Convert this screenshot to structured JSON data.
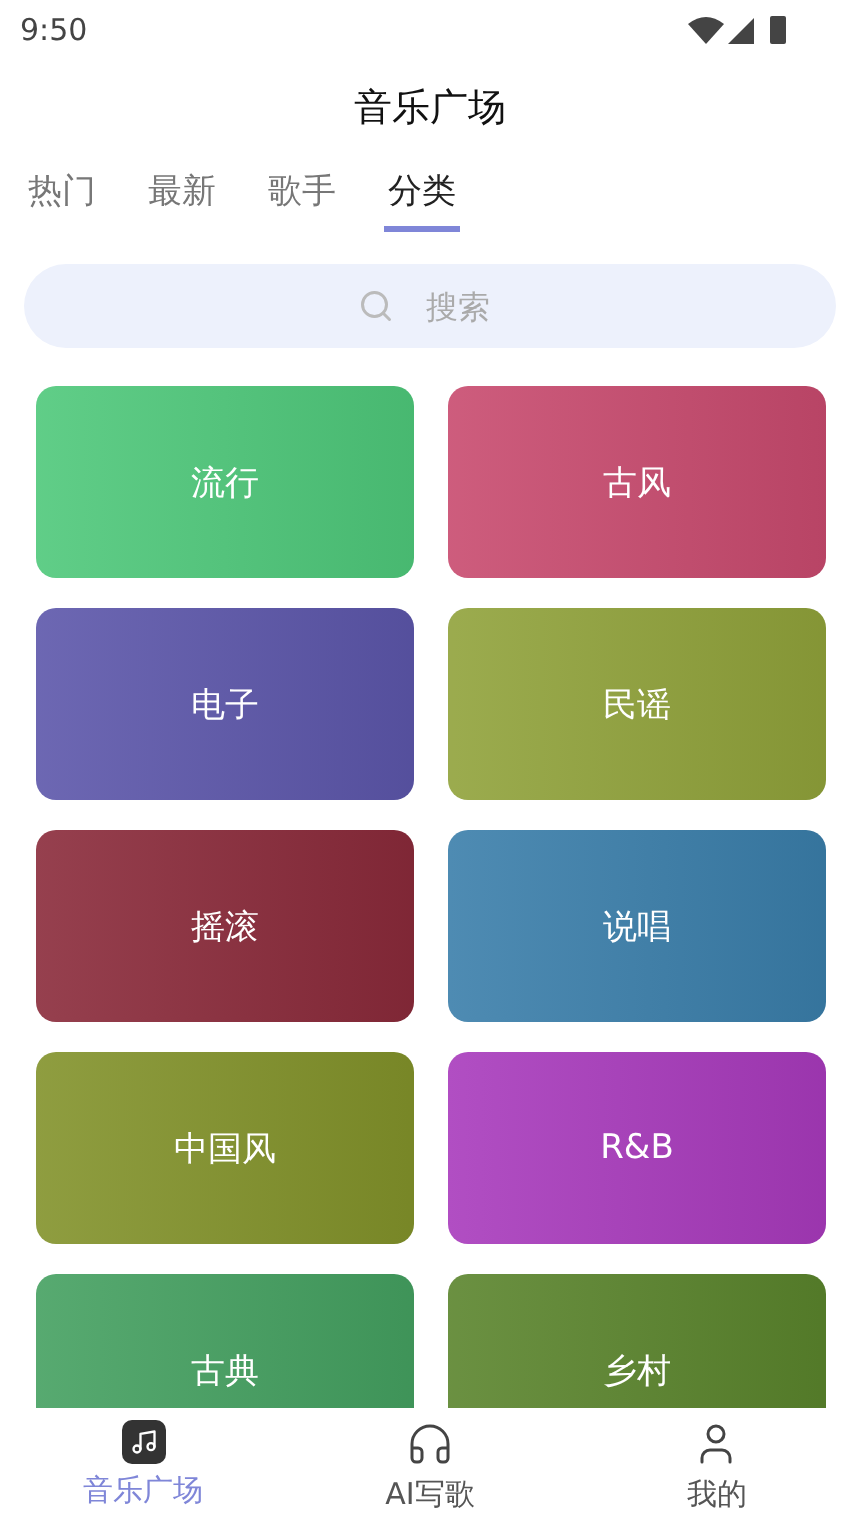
{
  "status_bar": {
    "time": "9:50"
  },
  "title": "音乐广场",
  "tabs": [
    {
      "label": "热门",
      "selected": false
    },
    {
      "label": "最新",
      "selected": false
    },
    {
      "label": "歌手",
      "selected": false
    },
    {
      "label": "分类",
      "selected": true
    }
  ],
  "search": {
    "placeholder": "搜索"
  },
  "categories": [
    {
      "label": "流行",
      "color": "#4ec87a"
    },
    {
      "label": "古风",
      "color": "#c84a6e"
    },
    {
      "label": "电子",
      "color": "#5c56aa"
    },
    {
      "label": "民谣",
      "color": "#90a23a"
    },
    {
      "label": "摇滚",
      "color": "#8a2a3a"
    },
    {
      "label": "说唱",
      "color": "#3a7eaa"
    },
    {
      "label": "中国风",
      "color": "#82922a"
    },
    {
      "label": "R&B",
      "color": "#a83abc"
    },
    {
      "label": "古典",
      "color": "#44a060"
    },
    {
      "label": "乡村",
      "color": "#5a842c"
    }
  ],
  "bottom_nav": [
    {
      "kind": "music",
      "label": "音乐广场",
      "selected": true
    },
    {
      "kind": "headphones",
      "label": "AI写歌",
      "selected": false
    },
    {
      "kind": "user",
      "label": "我的",
      "selected": false
    }
  ]
}
